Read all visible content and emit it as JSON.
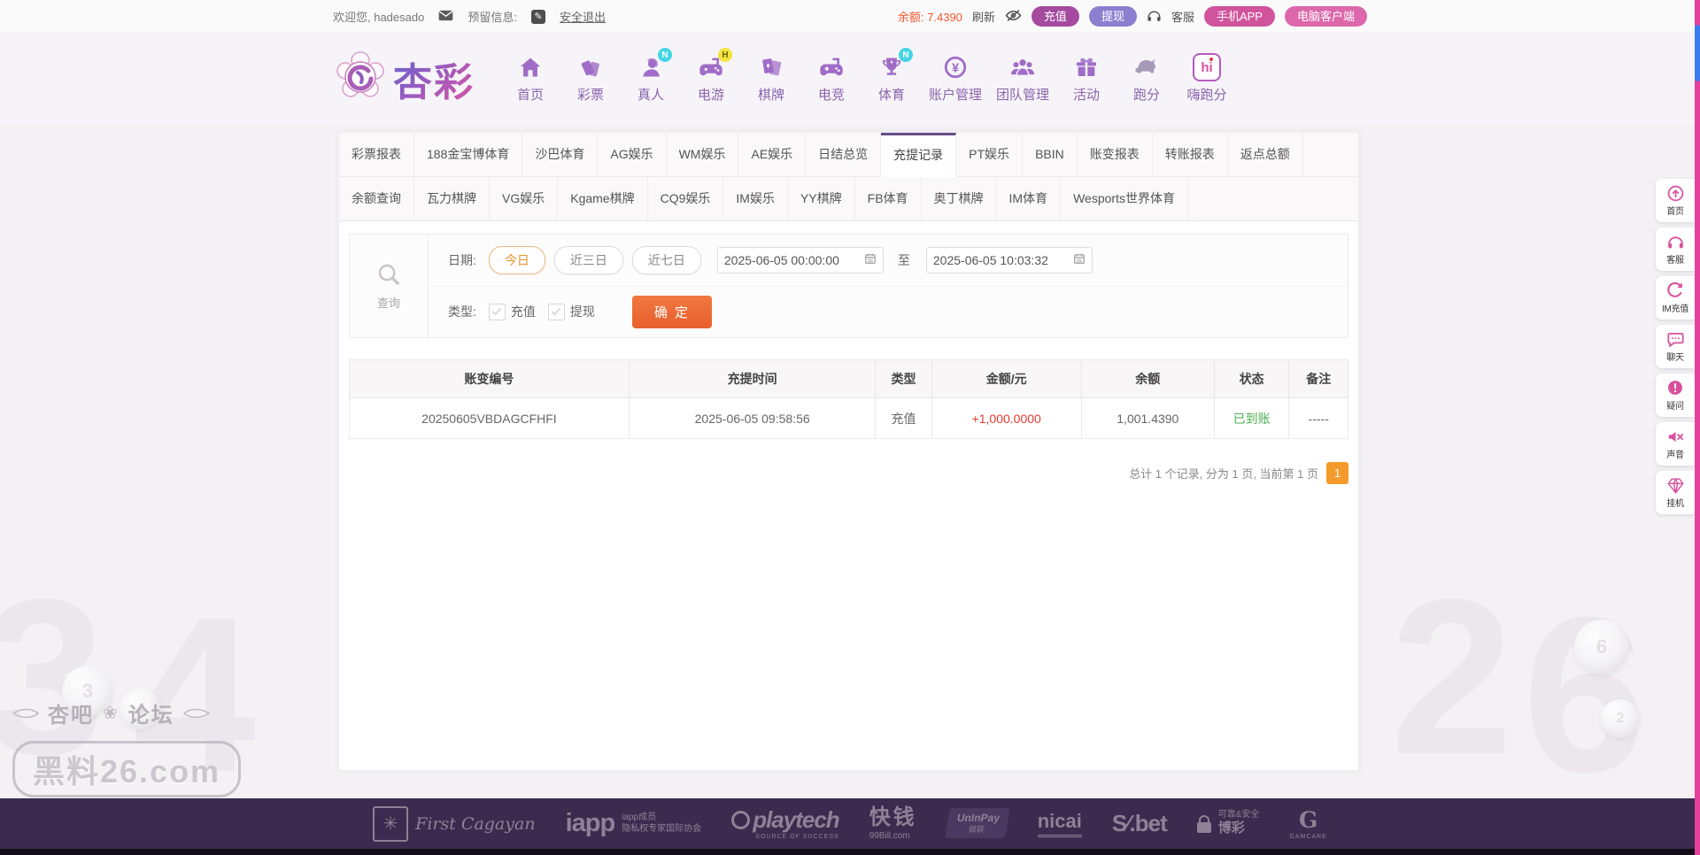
{
  "topbar": {
    "welcome": "欢迎您, hadesado",
    "reserved_label": "预留信息:",
    "logout": "安全退出",
    "balance_label": "余额:",
    "balance_value": "7.4390",
    "refresh": "刷新",
    "recharge": "充值",
    "withdraw": "提现",
    "service": "客服",
    "mobile_app": "手机APP",
    "pc_client": "电脑客户端"
  },
  "brand": {
    "name": "杏彩"
  },
  "nav": {
    "items": [
      {
        "label": "首页",
        "icon": "home-icon",
        "badge": ""
      },
      {
        "label": "彩票",
        "icon": "ticket-icon",
        "badge": ""
      },
      {
        "label": "真人",
        "icon": "live-person-icon",
        "badge": "N"
      },
      {
        "label": "电游",
        "icon": "slots-icon",
        "badge": "H"
      },
      {
        "label": "棋牌",
        "icon": "cards-icon",
        "badge": ""
      },
      {
        "label": "电竞",
        "icon": "esports-icon",
        "badge": ""
      },
      {
        "label": "体育",
        "icon": "trophy-icon",
        "badge": "N"
      },
      {
        "label": "账户管理",
        "icon": "account-icon",
        "badge": ""
      },
      {
        "label": "团队管理",
        "icon": "team-icon",
        "badge": ""
      },
      {
        "label": "活动",
        "icon": "gift-icon",
        "badge": ""
      },
      {
        "label": "跑分",
        "icon": "rhino-icon",
        "badge": ""
      },
      {
        "label": "嗨跑分",
        "icon": "hi-app-icon",
        "badge": ""
      }
    ]
  },
  "tabs": {
    "active": "充提记录",
    "row1": [
      "彩票报表",
      "188金宝博体育",
      "沙巴体育",
      "AG娱乐",
      "WM娱乐",
      "AE娱乐",
      "日结总览",
      "充提记录",
      "PT娱乐",
      "BBIN",
      "账变报表",
      "转账报表",
      "返点总额"
    ],
    "row2": [
      "余额查询",
      "瓦力棋牌",
      "VG娱乐",
      "Kgame棋牌",
      "CQ9娱乐",
      "IM娱乐",
      "YY棋牌",
      "FB体育",
      "奥丁棋牌",
      "IM体育",
      "Wesports世界体育"
    ]
  },
  "query": {
    "search_label": "查询",
    "date_label": "日期:",
    "presets": [
      {
        "label": "今日",
        "active": true
      },
      {
        "label": "近三日",
        "active": false
      },
      {
        "label": "近七日",
        "active": false
      }
    ],
    "date_from": "2025-06-05 00:00:00",
    "to_label": "至",
    "date_to": "2025-06-05 10:03:32",
    "type_label": "类型:",
    "types": [
      {
        "label": "充值",
        "checked": true
      },
      {
        "label": "提现",
        "checked": true
      }
    ],
    "submit": "确 定"
  },
  "table": {
    "headers": [
      "账变编号",
      "充提时间",
      "类型",
      "金额/元",
      "余额",
      "状态",
      "备注"
    ],
    "col_widths_pct": [
      28,
      24.7,
      5.6,
      15,
      13.3,
      7.5,
      5.9
    ],
    "rows": [
      [
        "20250605VBDAGCFHFI",
        "2025-06-05 09:58:56",
        "充值",
        "+1,000.0000",
        "1,001.4390",
        "已到账",
        "-----"
      ]
    ]
  },
  "pagination": {
    "summary": "总计 1 个记录, 分为 1 页, 当前第 1 页",
    "current": "1"
  },
  "sidebar": {
    "items": [
      {
        "label": "首页",
        "icon": "back-top-icon"
      },
      {
        "label": "客服",
        "icon": "service-icon"
      },
      {
        "label": "IM充值",
        "icon": "im-recharge-icon"
      },
      {
        "label": "聊天",
        "icon": "chat-icon"
      },
      {
        "label": "疑问",
        "icon": "question-icon"
      },
      {
        "label": "声音",
        "icon": "sound-mute-icon"
      },
      {
        "label": "挂机",
        "icon": "gem-icon"
      }
    ]
  },
  "watermark": {
    "line1a": "杏吧",
    "line1b": "论坛",
    "line2": "黑料26.com"
  },
  "footer": {
    "logos": [
      {
        "name": "first-cagayan",
        "title": "First Cagayan"
      },
      {
        "name": "iapp",
        "title": "iapp",
        "line1": "iapp成员",
        "line2": "隐私权专家国际协会"
      },
      {
        "name": "playtech",
        "title": "playtech",
        "sub": "SOURCE OF SUCCESS"
      },
      {
        "name": "99bill",
        "title": "快钱",
        "sub": "99Bill.com"
      },
      {
        "name": "uninpay",
        "title": "UnInPay",
        "sub": "银联"
      },
      {
        "name": "nicai",
        "title": "nicai"
      },
      {
        "name": "sbet",
        "title": "S∕.bet"
      },
      {
        "name": "secure",
        "line1": "可靠&安全",
        "line2": "博彩"
      },
      {
        "name": "gamcare",
        "title": "G",
        "sub": "GAMCARE"
      }
    ]
  },
  "colors": {
    "recharge_btn": "#a44a9f",
    "withdraw_btn": "#8a80cf",
    "mobile_app_btn": "#d0539c",
    "pc_client_btn": "#dd67ab",
    "balance_text": "#f0562f",
    "submit_btn": "#ea6a3a",
    "page_btn": "#f59b2c",
    "amount_red": "#e23a30",
    "status_green": "#4cae50",
    "tab_active_border": "#655087",
    "sidebar_icon_pink": "#d8509d",
    "footer_bg": "#3b2b4e",
    "scrollbar_track": "#e83e9c",
    "scrollbar_thumb": "#3a7bf0"
  }
}
